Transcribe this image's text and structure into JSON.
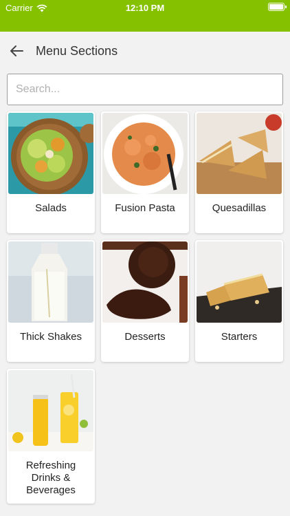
{
  "status_bar": {
    "carrier": "Carrier",
    "time": "12:10 PM"
  },
  "header": {
    "title": "Menu Sections"
  },
  "search": {
    "placeholder": "Search..."
  },
  "menu_sections": [
    {
      "label": "Salads",
      "image": "salad-photo"
    },
    {
      "label": "Fusion Pasta",
      "image": "pasta-photo"
    },
    {
      "label": "Quesadillas",
      "image": "quesadilla-photo"
    },
    {
      "label": "Thick Shakes",
      "image": "shake-photo"
    },
    {
      "label": "Desserts",
      "image": "dessert-photo"
    },
    {
      "label": "Starters",
      "image": "starter-photo"
    },
    {
      "label": "Refreshing Drinks & Beverages",
      "image": "drinks-photo"
    }
  ],
  "colors": {
    "status_bar": "#86c100",
    "background": "#f2f2f2"
  }
}
